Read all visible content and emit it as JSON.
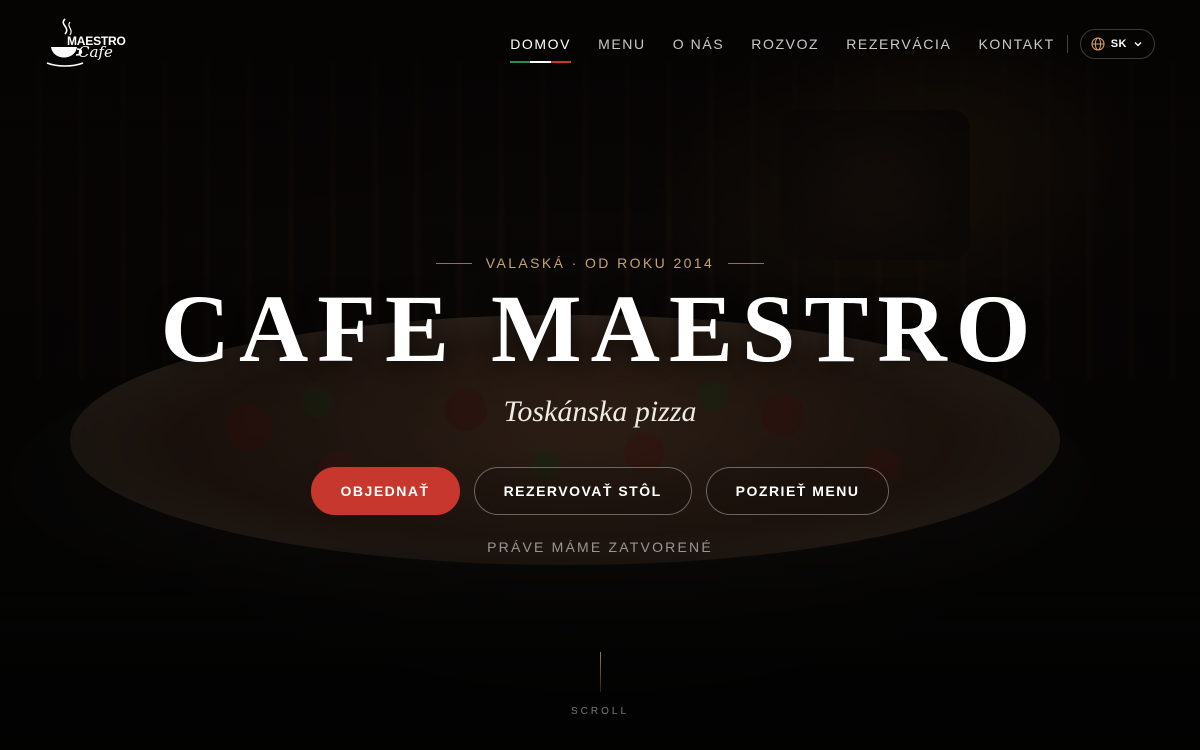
{
  "brand": {
    "logo_word": "MAESTRO",
    "logo_script": "Cafe"
  },
  "nav": {
    "items": [
      {
        "label": "DOMOV",
        "active": true
      },
      {
        "label": "MENU",
        "active": false
      },
      {
        "label": "O NÁS",
        "active": false
      },
      {
        "label": "ROZVOZ",
        "active": false
      },
      {
        "label": "REZERVÁCIA",
        "active": false
      },
      {
        "label": "KONTAKT",
        "active": false
      }
    ],
    "active_underline_colors": [
      "#2e8b4a",
      "#ffffff",
      "#c8372d"
    ]
  },
  "language": {
    "selected": "SK",
    "icon": "globe-icon",
    "dropdown_icon": "chevron-down-icon"
  },
  "hero": {
    "eyebrow": "VALASKÁ · OD ROKU 2014",
    "title": "CAFE MAESTRO",
    "subtitle": "Toskánska pizza",
    "buttons": {
      "order": "OBJEDNAŤ",
      "reserve": "REZERVOVAŤ STÔL",
      "menu": "POZRIEŤ MENU"
    },
    "status": "PRÁVE MÁME ZATVORENÉ"
  },
  "scroll": {
    "label": "SCROLL"
  },
  "colors": {
    "accent_red": "#c8372d",
    "accent_gold": "#c7a16e",
    "background": "#0d0a08"
  }
}
